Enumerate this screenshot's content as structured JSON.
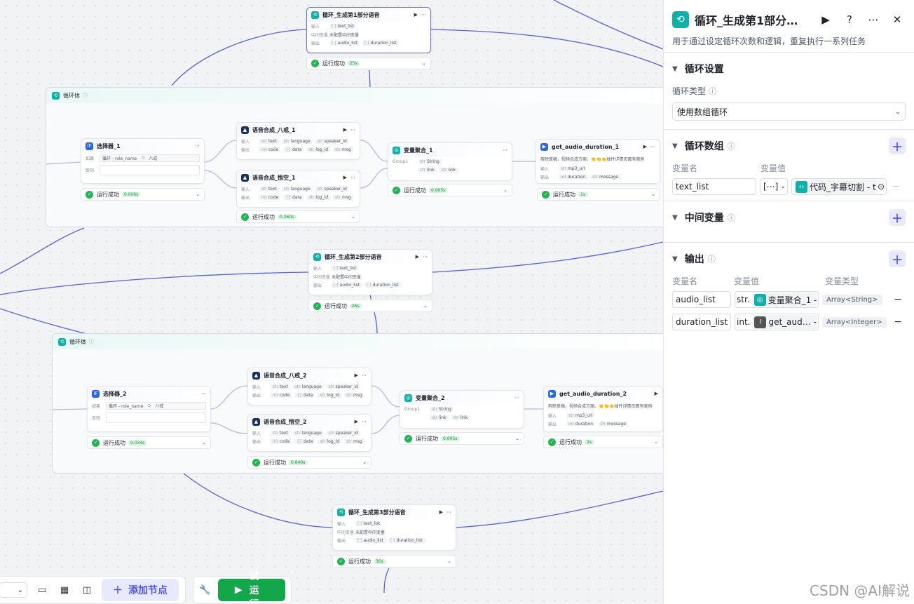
{
  "canvas": {
    "loop_top": {
      "title": "循环_生成第1部分语音",
      "in_label": "输入",
      "in_val": "text_list",
      "mid_label": "中间变量",
      "mid_val": "未配置中间变量",
      "out_label": "输出",
      "out1": "audio_list",
      "out2": "duration_list",
      "status": "运行成功",
      "time": "25s"
    },
    "loop_body_1": {
      "title": "循环体",
      "selector": {
        "title": "选择器_1",
        "if_label": "如果",
        "cond_left": "循环 - role_name",
        "op": "⊃",
        "cond_right": "八戒",
        "else_label": "否则",
        "status": "运行成功",
        "time": "0.006s"
      },
      "tts_a": {
        "title": "语音合成_八戒_1",
        "in": [
          "text",
          "language",
          "speaker_id"
        ],
        "out": [
          "code",
          "data",
          "log_id",
          "msg"
        ],
        "in_label": "输入",
        "out_label": "输出"
      },
      "tts_b": {
        "title": "语音合成_悟空_1",
        "in": [
          "text",
          "language",
          "speaker_id"
        ],
        "out": [
          "code",
          "data",
          "log_id",
          "msg"
        ],
        "in_label": "输入",
        "out_label": "输出",
        "status": "运行成功",
        "time": "0.260s"
      },
      "agg": {
        "title": "变量聚合_1",
        "group": "Group1",
        "type": "String",
        "v1": "link",
        "v2": "link",
        "status": "运行成功",
        "time": "0.005s"
      },
      "dur": {
        "title": "get_audio_duration_1",
        "desc": "剪映草稿，视频合成方案。👏👏👏插件详情页面有案例",
        "in_label": "输入",
        "in": "mp3_url",
        "out_label": "输出",
        "out1": "duration",
        "out2": "message",
        "status": "运行成功",
        "time": "1s"
      }
    },
    "loop_mid": {
      "title": "循环_生成第2部分语音",
      "in_label": "输入",
      "in_val": "text_list",
      "mid_label": "中间变量",
      "mid_val": "未配置中间变量",
      "out_label": "输出",
      "out1": "audio_list",
      "out2": "duration_list",
      "status": "运行成功",
      "time": "26s"
    },
    "loop_body_2": {
      "title": "循环体",
      "selector": {
        "title": "选择器_2",
        "if_label": "如果",
        "cond_left": "循环 - role_name",
        "op": "⊃",
        "cond_right": "八戒",
        "else_label": "否则",
        "status": "运行成功",
        "time": "0.034s"
      },
      "tts_a": {
        "title": "语音合成_八戒_2",
        "in": [
          "text",
          "language",
          "speaker_id"
        ],
        "out": [
          "code",
          "data",
          "log_id",
          "msg"
        ],
        "in_label": "输入",
        "out_label": "输出"
      },
      "tts_b": {
        "title": "语音合成_悟空_2",
        "in": [
          "text",
          "language",
          "speaker_id"
        ],
        "out": [
          "code",
          "data",
          "log_id",
          "msg"
        ],
        "in_label": "输入",
        "out_label": "输出",
        "status": "运行成功",
        "time": "0.640s"
      },
      "agg": {
        "title": "变量聚合_2",
        "group": "Group1",
        "type": "String",
        "v1": "link",
        "v2": "link",
        "status": "运行成功",
        "time": "0.005s"
      },
      "dur": {
        "title": "get_audio_duration_2",
        "desc": "剪映草稿，视频合成方案。👏👏👏插件详情页面有案例",
        "in_label": "输入",
        "in": "mp3_url",
        "out_label": "输出",
        "out1": "duration",
        "out2": "message",
        "status": "运行成功",
        "time": "2s"
      }
    },
    "loop_bottom": {
      "title": "循环_生成第3部分语音",
      "in_label": "输入",
      "in_val": "text_list",
      "mid_label": "中间变量",
      "mid_val": "未配置中间变量",
      "out_label": "输出",
      "out1": "audio_list",
      "out2": "duration_list",
      "status": "运行成功",
      "time": "30s"
    }
  },
  "toolbar": {
    "add_node": "添加节点",
    "test_run": "试运行"
  },
  "watermark": "CSDN @AI解说",
  "panel": {
    "title": "循环_生成第1部分…",
    "description": "用于通过设定循环次数和逻辑，重复执行一系列任务",
    "loop_settings": {
      "header": "循环设置",
      "type_label": "循环类型",
      "type_value": "使用数组循环"
    },
    "loop_array": {
      "header": "循环数组",
      "col_name": "变量名",
      "col_value": "变量值",
      "row_name": "text_list",
      "row_type": "[⋯]",
      "row_ref": "代码_字幕切割 - t"
    },
    "mid_vars": {
      "header": "中间变量"
    },
    "outputs": {
      "header": "输出",
      "col_name": "变量名",
      "col_value": "变量值",
      "col_type": "变量类型",
      "rows": [
        {
          "name": "audio_list",
          "prefix": "str.",
          "ref": "变量聚合_1 -",
          "type": "Array<String>"
        },
        {
          "name": "duration_list",
          "prefix": "int.",
          "ref": "get_aud… -",
          "type": "Array<Integer>"
        }
      ]
    }
  },
  "colors": {
    "accent": "#4d53e8",
    "success": "#1fb550",
    "loop_icon": "#0fb0a8",
    "edge": "#4d53e8"
  }
}
